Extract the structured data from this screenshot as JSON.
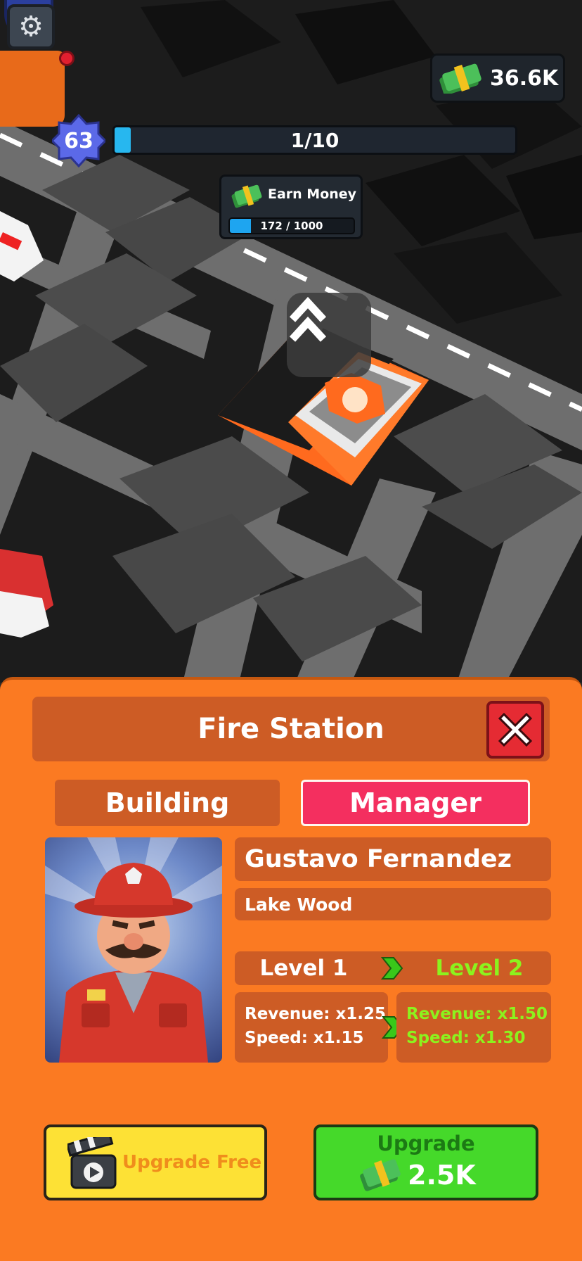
{
  "hud": {
    "money": "36.6K",
    "player_level": "63",
    "progress_text": "1/10",
    "progress_fraction": 0.1
  },
  "quest": {
    "title": "Earn Money",
    "progress_text": "172 / 1000",
    "progress_fraction": 0.172
  },
  "panel": {
    "title": "Fire Station",
    "tabs": {
      "building": "Building",
      "manager": "Manager"
    },
    "manager": {
      "name": "Gustavo Fernandez",
      "location": "Lake Wood",
      "current_level": "Level 1",
      "next_level": "Level 2",
      "current_revenue": "Revenue: x1.25",
      "current_speed": "Speed: x1.15",
      "next_revenue": "Revenue: x1.50",
      "next_speed": "Speed: x1.30"
    },
    "buttons": {
      "upgrade_free": "Upgrade Free",
      "upgrade": "Upgrade",
      "upgrade_price": "2.5K"
    }
  },
  "colors": {
    "panel_orange": "#fb7a22",
    "box_orange": "#cd5c25",
    "manager_tab": "#f42f5f",
    "next_level_green": "#8cf21e",
    "upgrade_green": "#45d92a",
    "free_yellow": "#fde135"
  }
}
